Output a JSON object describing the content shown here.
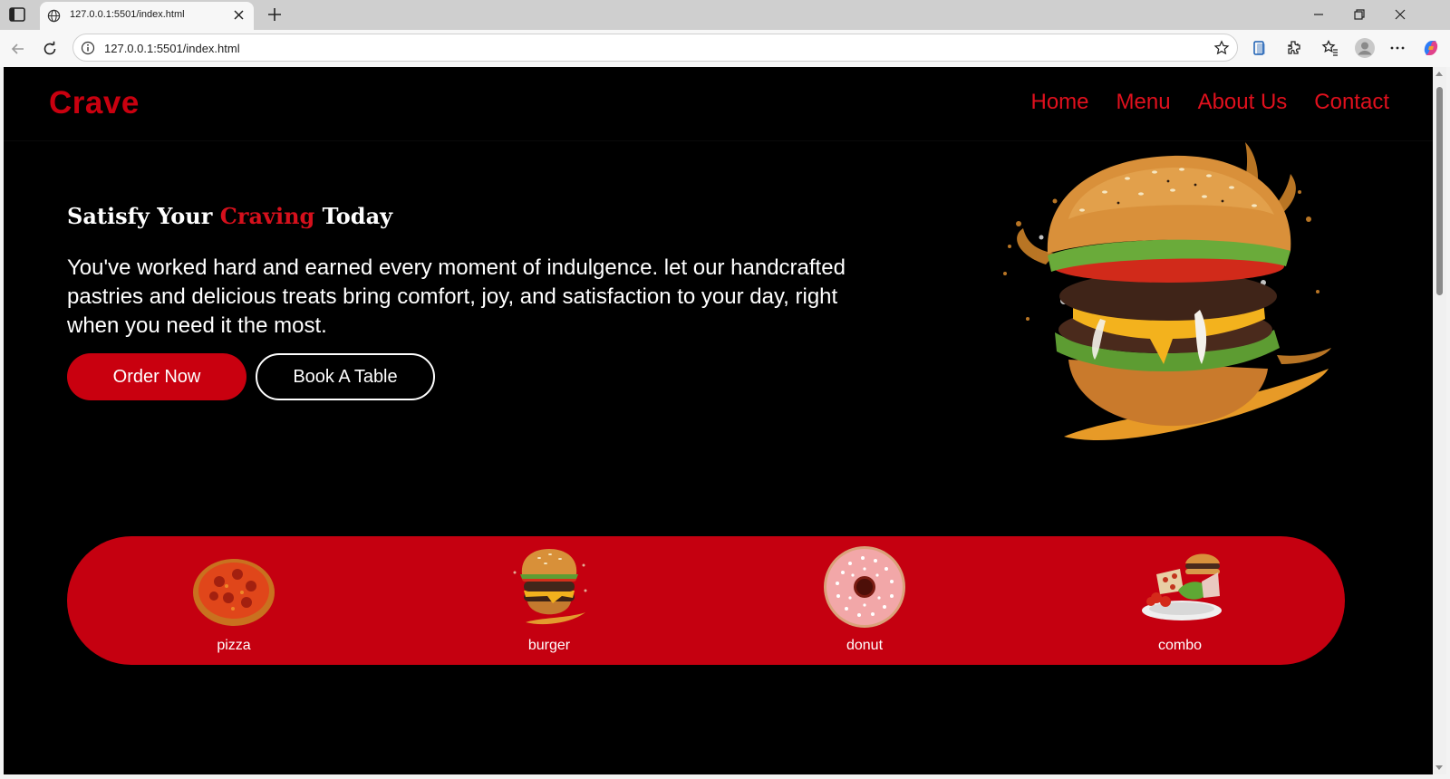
{
  "browser": {
    "tab_title": "127.0.0.1:5501/index.html",
    "url": "127.0.0.1:5501/index.html"
  },
  "site": {
    "logo": "Crave",
    "nav": [
      "Home",
      "Menu",
      "About Us",
      "Contact"
    ],
    "hero": {
      "title_before": "Satisfy Your ",
      "title_accent": "Craving",
      "title_after": " Today",
      "description": "You've worked hard and earned every moment of indulgence. let our handcrafted pastries and delicious treats bring comfort, joy, and satisfaction to your day, right when you need it the most.",
      "order_button": "Order Now",
      "book_button": "Book A Table",
      "image_icon": "burger-splash-image"
    },
    "categories": [
      {
        "label": "pizza",
        "icon": "pizza-icon"
      },
      {
        "label": "burger",
        "icon": "burger-icon"
      },
      {
        "label": "donut",
        "icon": "donut-icon"
      },
      {
        "label": "combo",
        "icon": "combo-plate-icon"
      }
    ]
  },
  "colors": {
    "brand_red": "#c9000f",
    "category_bar": "#c50010",
    "background": "#000000",
    "text": "#ffffff"
  }
}
